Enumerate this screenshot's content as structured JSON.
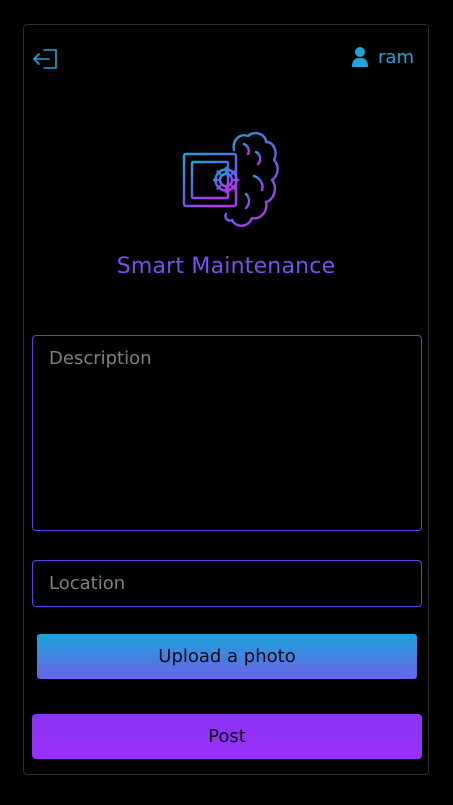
{
  "header": {
    "logout_icon": "logout-icon",
    "user_icon": "user-icon",
    "username": "ram"
  },
  "app": {
    "title": "Smart Maintenance",
    "logo_icon": "chip-brain-logo"
  },
  "form": {
    "description_placeholder": "Description",
    "description_value": "",
    "location_placeholder": "Location",
    "location_value": "",
    "upload_label": "Upload a photo",
    "post_label": "Post"
  },
  "colors": {
    "accent_blue": "#1da6d8",
    "accent_purple": "#7b4ef0",
    "border_purple": "#6a3ae6",
    "post_button": "#9231f8",
    "background": "#000000"
  }
}
